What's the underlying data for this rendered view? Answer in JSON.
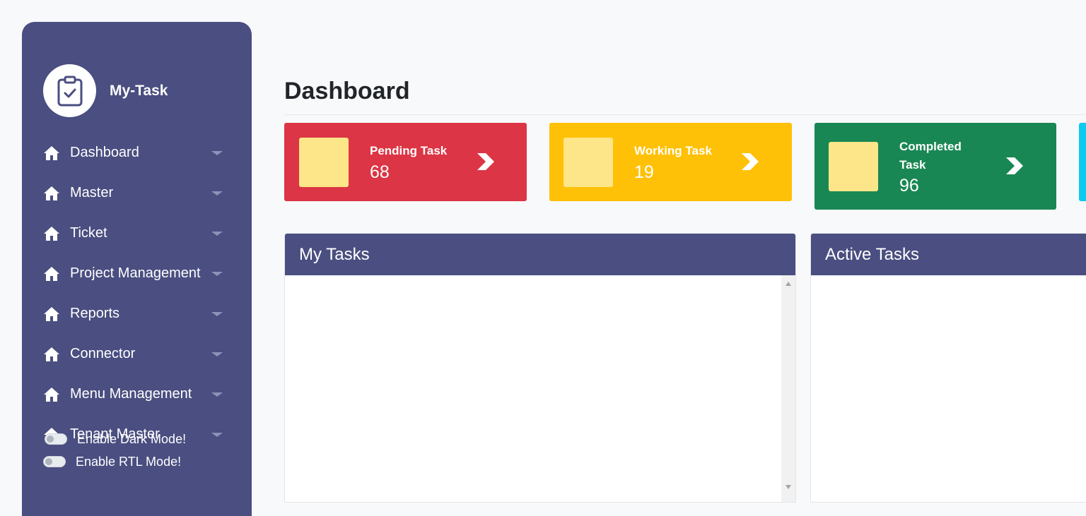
{
  "app": {
    "name": "My-Task"
  },
  "sidebar": {
    "items": [
      {
        "label": "Dashboard"
      },
      {
        "label": "Master"
      },
      {
        "label": "Ticket"
      },
      {
        "label": "Project Management"
      },
      {
        "label": "Reports"
      },
      {
        "label": "Connector"
      },
      {
        "label": "Menu Management"
      },
      {
        "label": "Tenant Master"
      }
    ],
    "toggles": {
      "dark_mode": {
        "label": "Enable Dark Mode!",
        "enabled": false
      },
      "rtl_mode": {
        "label": "Enable RTL Mode!",
        "enabled": false
      }
    }
  },
  "main": {
    "title": "Dashboard",
    "cards": [
      {
        "label": "Pending Task",
        "count": "68",
        "color": "#dc3545"
      },
      {
        "label": "Working Task",
        "count": "19",
        "color": "#ffc107"
      },
      {
        "label_line1": "Completed",
        "label_line2": "Task",
        "count": "96",
        "color": "#198754"
      }
    ],
    "panels": {
      "my_tasks": {
        "title": "My Tasks"
      },
      "active_tasks": {
        "title": "Active Tasks"
      }
    }
  },
  "colors": {
    "sidebar": "#4a4e80",
    "thumb": "#fde68a",
    "edge_card": "#0dcaf0"
  },
  "icons": {
    "logo": "clipboard-check-icon",
    "nav": "home-icon",
    "card_action": "chevron-right-icon"
  }
}
